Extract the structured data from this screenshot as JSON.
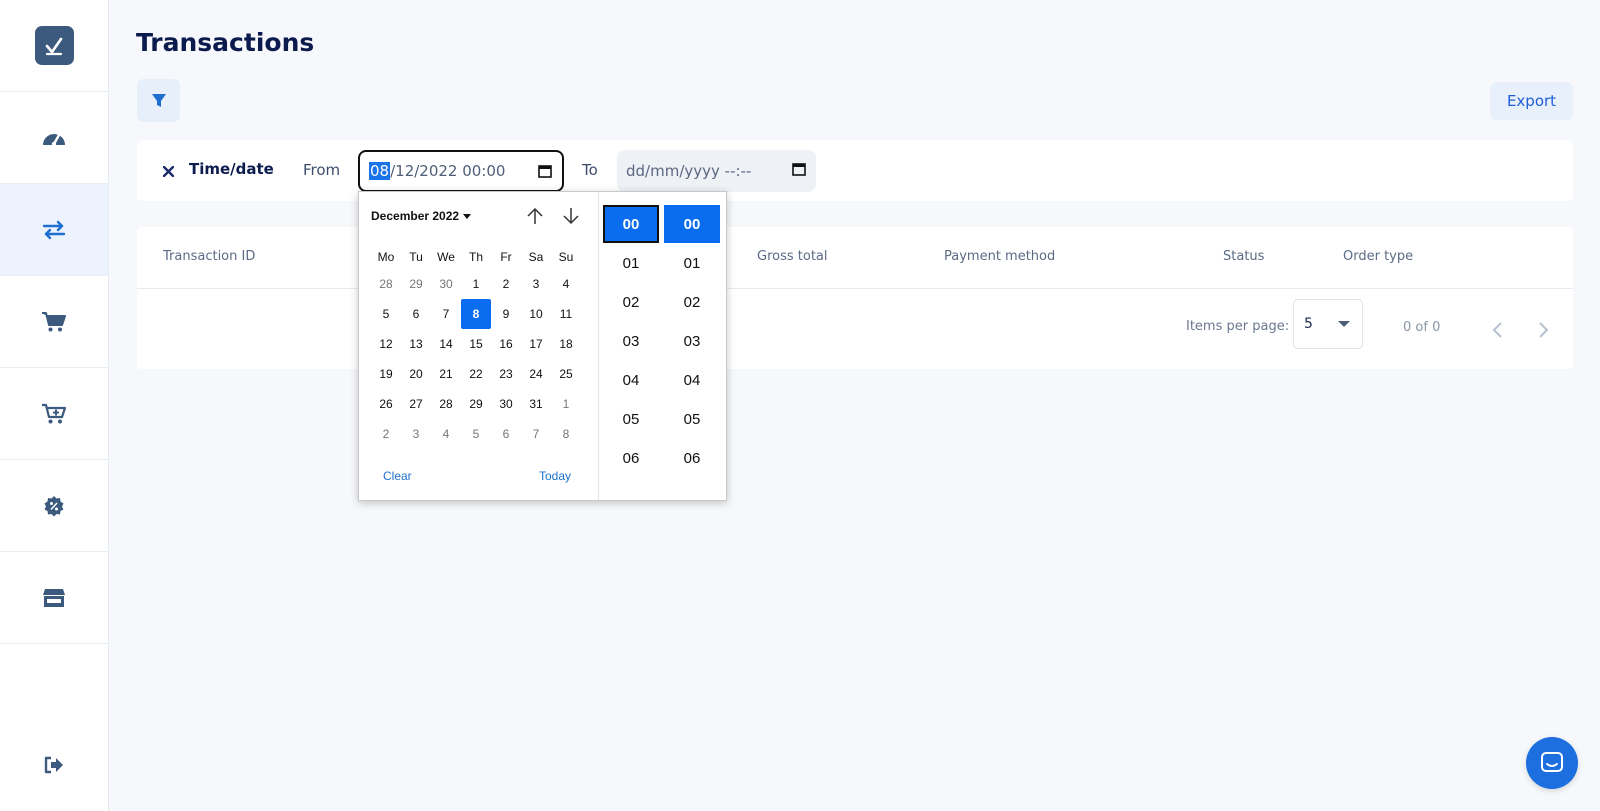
{
  "page": {
    "title": "Transactions"
  },
  "toolbar": {
    "export_label": "Export"
  },
  "filter": {
    "label": "Time/date",
    "from_label": "From",
    "to_label": "To",
    "from_value_selected": "08",
    "from_value_rest": "/12/2022 00:00",
    "to_placeholder": "dd/mm/yyyy --:--"
  },
  "table": {
    "columns": [
      "Transaction ID",
      "Gross total",
      "Payment method",
      "Status",
      "Order type"
    ]
  },
  "pagination": {
    "items_per_page_label": "Items per page:",
    "items_per_page_value": "5",
    "range": "0 of 0"
  },
  "datepicker": {
    "month_label": "December 2022",
    "weekdays": [
      "Mo",
      "Tu",
      "We",
      "Th",
      "Fr",
      "Sa",
      "Su"
    ],
    "weeks": [
      [
        "28",
        "29",
        "30",
        "1",
        "2",
        "3",
        "4"
      ],
      [
        "5",
        "6",
        "7",
        "8",
        "9",
        "10",
        "11"
      ],
      [
        "12",
        "13",
        "14",
        "15",
        "16",
        "17",
        "18"
      ],
      [
        "19",
        "20",
        "21",
        "22",
        "23",
        "24",
        "25"
      ],
      [
        "26",
        "27",
        "28",
        "29",
        "30",
        "31",
        "1"
      ],
      [
        "2",
        "3",
        "4",
        "5",
        "6",
        "7",
        "8"
      ]
    ],
    "selected_day": "8",
    "clear_label": "Clear",
    "today_label": "Today",
    "hours": [
      "00",
      "01",
      "02",
      "03",
      "04",
      "05",
      "06"
    ],
    "minutes": [
      "00",
      "01",
      "02",
      "03",
      "04",
      "05",
      "06"
    ]
  },
  "colors": {
    "accent": "#0a6df0",
    "sidebar_active_bg": "#edf3fc",
    "icon": "#3c5a7d",
    "icon_active": "#1f6fd0"
  }
}
